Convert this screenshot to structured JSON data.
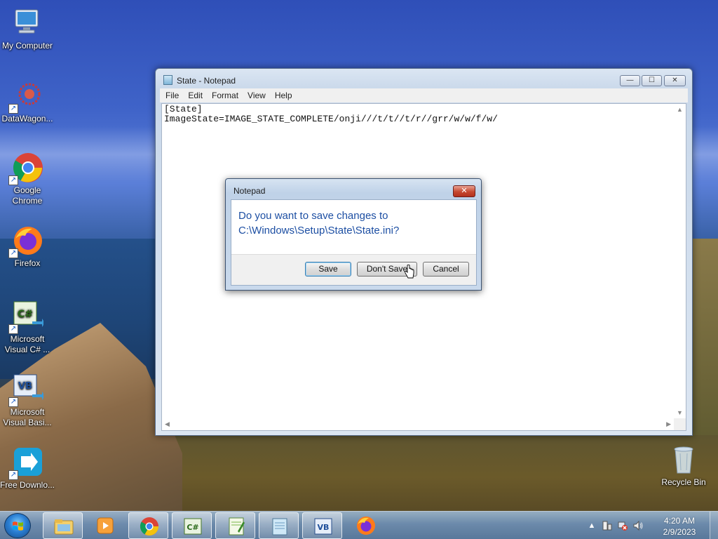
{
  "desktop": {
    "icons": [
      {
        "label": "My Computer"
      },
      {
        "label": "DataWagon..."
      },
      {
        "label": "Google Chrome"
      },
      {
        "label": "Firefox"
      },
      {
        "label": "Microsoft Visual C# ..."
      },
      {
        "label": "Microsoft Visual Basi..."
      },
      {
        "label": "Free Downlo..."
      },
      {
        "label": "Recycle Bin"
      }
    ]
  },
  "notepad": {
    "title": "State - Notepad",
    "menu": [
      "File",
      "Edit",
      "Format",
      "View",
      "Help"
    ],
    "content_line1": "[State]",
    "content_line2": "ImageState=IMAGE_STATE_COMPLETE/onji///t/t//t/r//grr/w/w/f/w/",
    "buttons": {
      "minimize": "—",
      "maximize": "☐",
      "close": "✕"
    }
  },
  "dialog": {
    "title": "Notepad",
    "message": "Do you want to save changes to C:\\Windows\\Setup\\State\\State.ini?",
    "buttons": {
      "save": "Save",
      "dont_save": "Don't Save",
      "cancel": "Cancel"
    },
    "close": "✕"
  },
  "taskbar": {
    "items": [
      "Windows Explorer",
      "Windows Media Player",
      "Google Chrome",
      "Microsoft Visual C#",
      "Notepad++",
      "Notepad",
      "Microsoft Visual Basic",
      "Firefox"
    ],
    "clock_time": "4:20 AM",
    "clock_date": "2/9/2023",
    "tray_arrow": "▲"
  },
  "colors": {
    "dialog_text": "#1d4fa3",
    "close_red": "#c6482f"
  }
}
